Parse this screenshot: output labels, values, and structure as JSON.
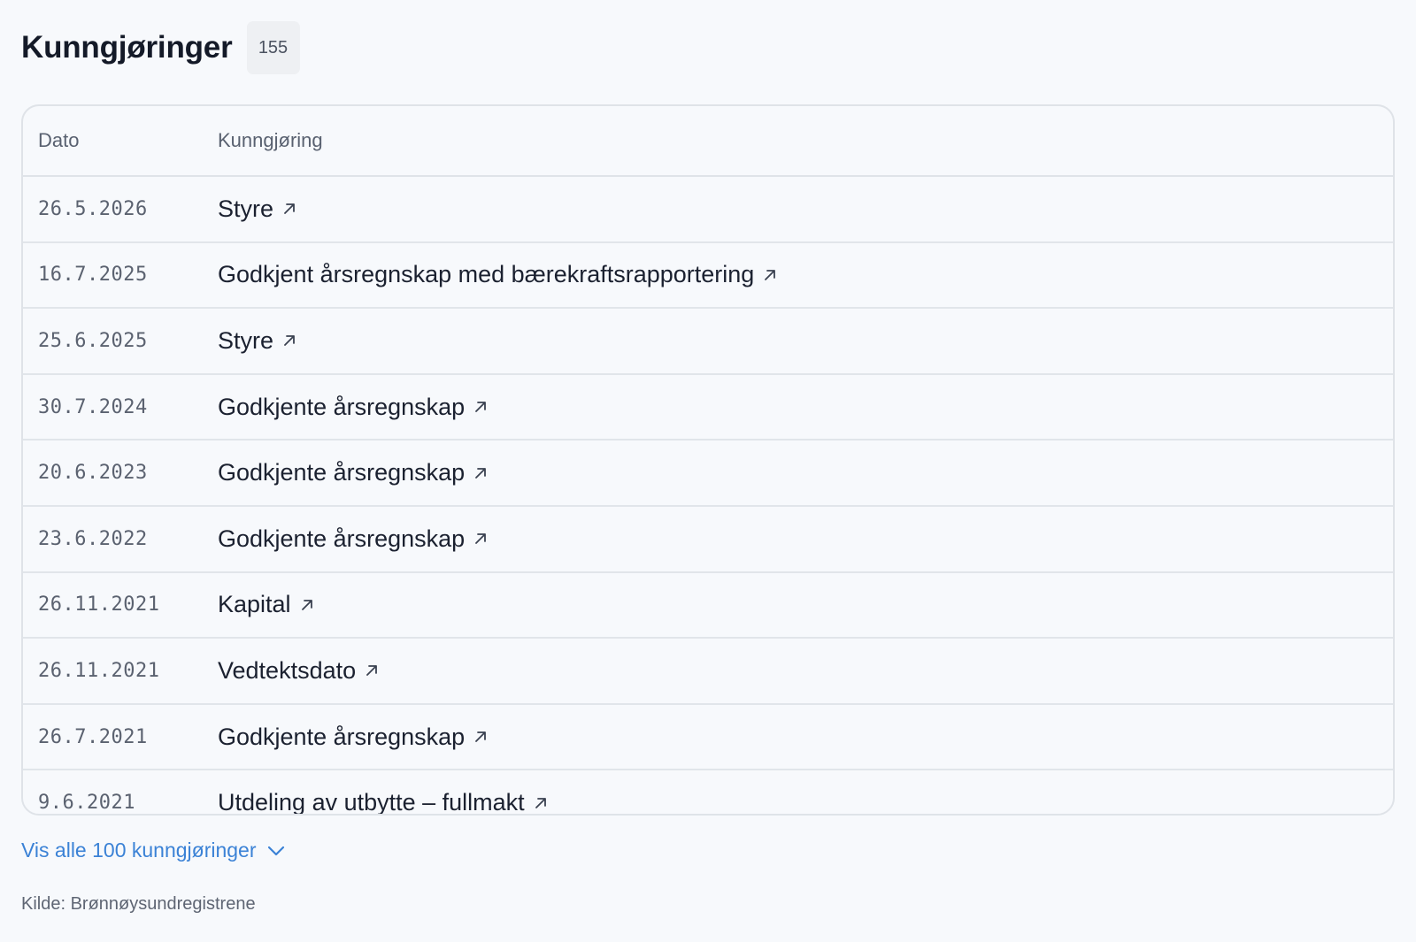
{
  "header": {
    "title": "Kunngjøringer",
    "count": "155"
  },
  "table": {
    "columns": {
      "date": "Dato",
      "announcement": "Kunngjøring"
    },
    "rows": [
      {
        "date": "26.5.2026",
        "text": "Styre"
      },
      {
        "date": "16.7.2025",
        "text": "Godkjent årsregnskap med bærekraftsrapportering"
      },
      {
        "date": "25.6.2025",
        "text": "Styre"
      },
      {
        "date": "30.7.2024",
        "text": "Godkjente årsregnskap"
      },
      {
        "date": "20.6.2023",
        "text": "Godkjente årsregnskap"
      },
      {
        "date": "23.6.2022",
        "text": "Godkjente årsregnskap"
      },
      {
        "date": "26.11.2021",
        "text": "Kapital"
      },
      {
        "date": "26.11.2021",
        "text": "Vedtektsdato"
      },
      {
        "date": "26.7.2021",
        "text": "Godkjente årsregnskap"
      },
      {
        "date": "9.6.2021",
        "text": "Utdeling av utbytte – fullmakt"
      }
    ],
    "link_icon": "external-link-arrow-icon"
  },
  "show_all": {
    "label": "Vis alle 100 kunngjøringer",
    "icon": "chevron-down-icon"
  },
  "source": "Kilde: Brønnøysundregistrene",
  "colors": {
    "background": "#f7f9fc",
    "border": "#dfe3e8",
    "link_blue": "#3b82d6",
    "text": "#1b2130",
    "muted": "#5b6270"
  }
}
